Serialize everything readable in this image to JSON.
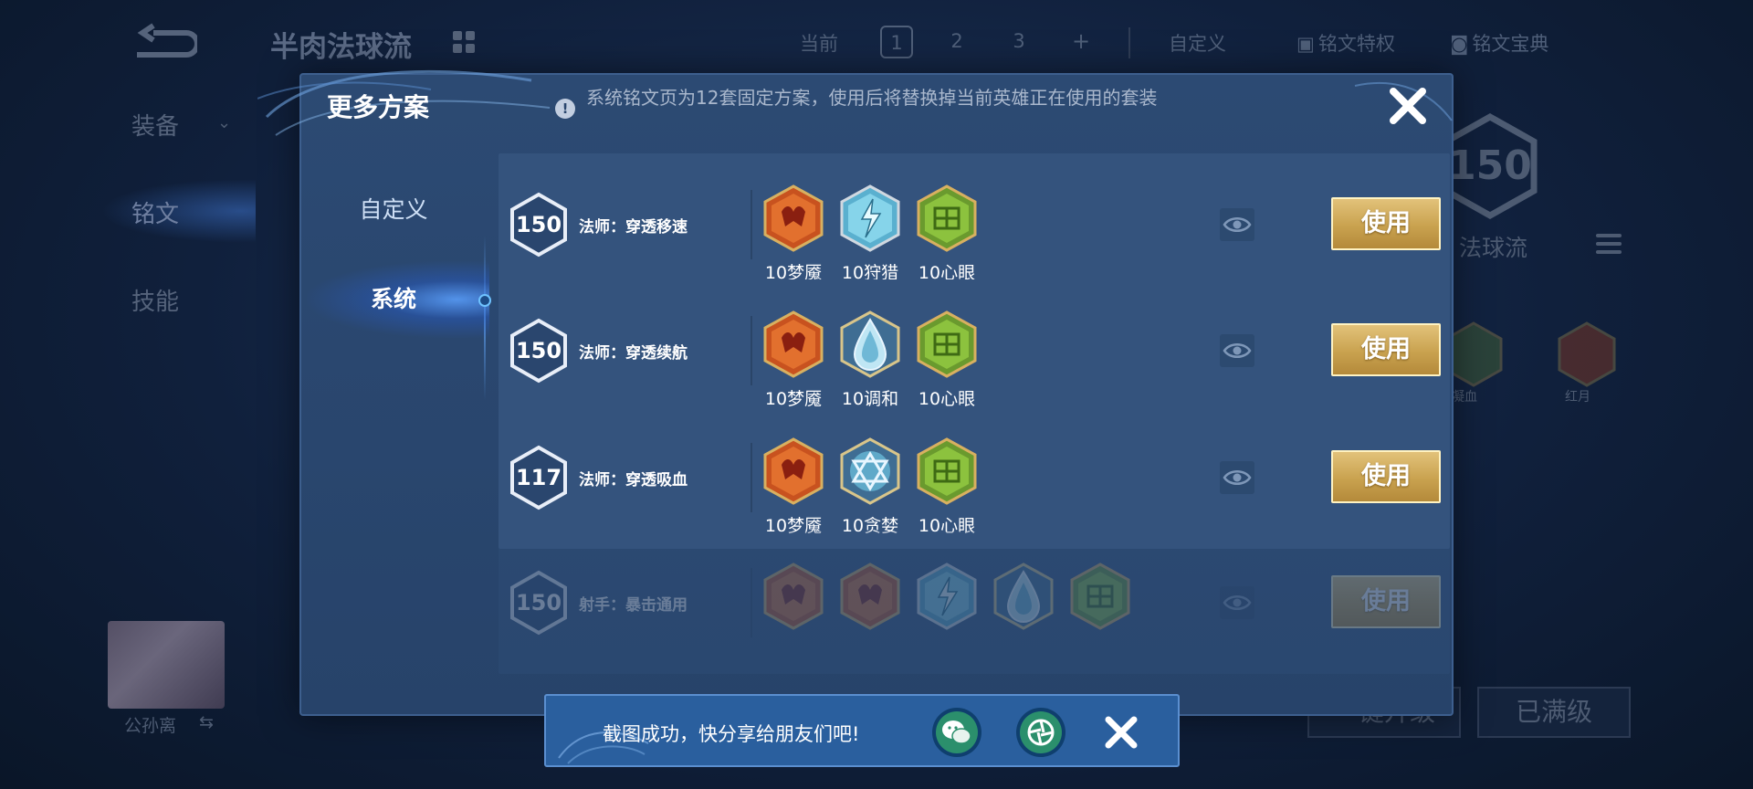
{
  "background": {
    "page_title": "半肉法球流",
    "current_label": "当前",
    "pages": [
      "1",
      "2",
      "3",
      "+"
    ],
    "active_page": "1",
    "top_links": [
      "自定义",
      "铭文特权",
      "铭文宝典"
    ],
    "sidebar": [
      "装备",
      "铭文",
      "技能"
    ],
    "level": "150",
    "hero_name": "法球流",
    "rune_labels": [
      "凝血",
      "红月"
    ],
    "portrait_label": "公孙离",
    "buttons": [
      "一键升级",
      "已满级"
    ]
  },
  "modal": {
    "title": "更多方案",
    "notice": "系统铭文页为12套固定方案，使用后将替换掉当前英雄正在使用的套装",
    "tabs": {
      "custom": "自定义",
      "system": "系统"
    },
    "use_label": "使用",
    "rows": [
      {
        "level": "150",
        "name": "法师：穿透移速",
        "runes": [
          {
            "label": "10梦魇",
            "type": "red"
          },
          {
            "label": "10狩猎",
            "type": "blue-bolt"
          },
          {
            "label": "10心眼",
            "type": "green"
          }
        ]
      },
      {
        "level": "150",
        "name": "法师：穿透续航",
        "runes": [
          {
            "label": "10梦魇",
            "type": "red"
          },
          {
            "label": "10调和",
            "type": "blue-drop"
          },
          {
            "label": "10心眼",
            "type": "green"
          }
        ]
      },
      {
        "level": "117",
        "name": "法师：穿透吸血",
        "runes": [
          {
            "label": "10梦魇",
            "type": "red"
          },
          {
            "label": "10贪婪",
            "type": "blue-star"
          },
          {
            "label": "10心眼",
            "type": "green"
          }
        ]
      },
      {
        "level": "150",
        "name": "射手：暴击通用",
        "runes": [
          {
            "label": "",
            "type": "red"
          },
          {
            "label": "",
            "type": "red"
          },
          {
            "label": "",
            "type": "blue-bolt"
          },
          {
            "label": "",
            "type": "blue-drop"
          },
          {
            "label": "",
            "type": "green"
          }
        ]
      }
    ]
  },
  "toast": {
    "message": "截图成功，快分享给朋友们吧!",
    "icons": [
      "wechat-icon",
      "moments-icon",
      "close-icon"
    ]
  },
  "colors": {
    "modal_bg": "#2c4a73",
    "row_bg": "#34537d",
    "use_button": "#c9a24f",
    "toast_bg": "#2a5f9e"
  }
}
